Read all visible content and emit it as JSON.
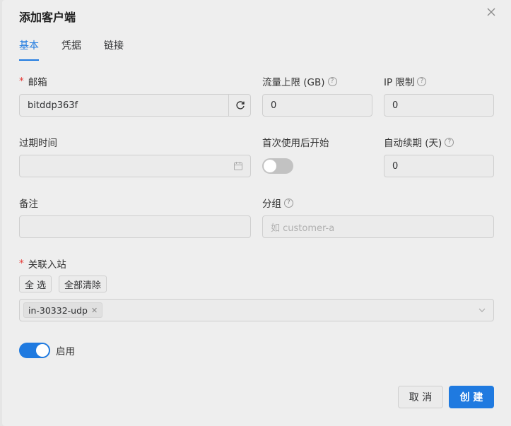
{
  "dialog": {
    "title": "添加客户端"
  },
  "tabs": [
    {
      "label": "基本",
      "active": true
    },
    {
      "label": "凭据",
      "active": false
    },
    {
      "label": "链接",
      "active": false
    }
  ],
  "form": {
    "email": {
      "label": "邮箱",
      "value": "bitddp363f",
      "required": true
    },
    "traffic_limit": {
      "label": "流量上限 (GB)",
      "value": "0"
    },
    "ip_limit": {
      "label": "IP 限制",
      "value": "0"
    },
    "expiry": {
      "label": "过期时间",
      "value": ""
    },
    "start_after_first_use": {
      "label": "首次使用后开始",
      "enabled": false
    },
    "auto_renew": {
      "label": "自动续期 (天)",
      "value": "0"
    },
    "remark": {
      "label": "备注",
      "value": ""
    },
    "group": {
      "label": "分组",
      "placeholder": "如 customer-a"
    },
    "inbounds": {
      "label": "关联入站",
      "required": true,
      "select_all_label": "全 选",
      "clear_all_label": "全部清除",
      "selected": [
        "in-30332-udp"
      ]
    },
    "enable": {
      "label": "启用",
      "enabled": true
    }
  },
  "footer": {
    "cancel_label": "取 消",
    "create_label": "创 建"
  },
  "colors": {
    "primary": "#1f7ae0",
    "required": "#e53935"
  },
  "icons": {
    "help": "?",
    "tag_close": "✕"
  }
}
